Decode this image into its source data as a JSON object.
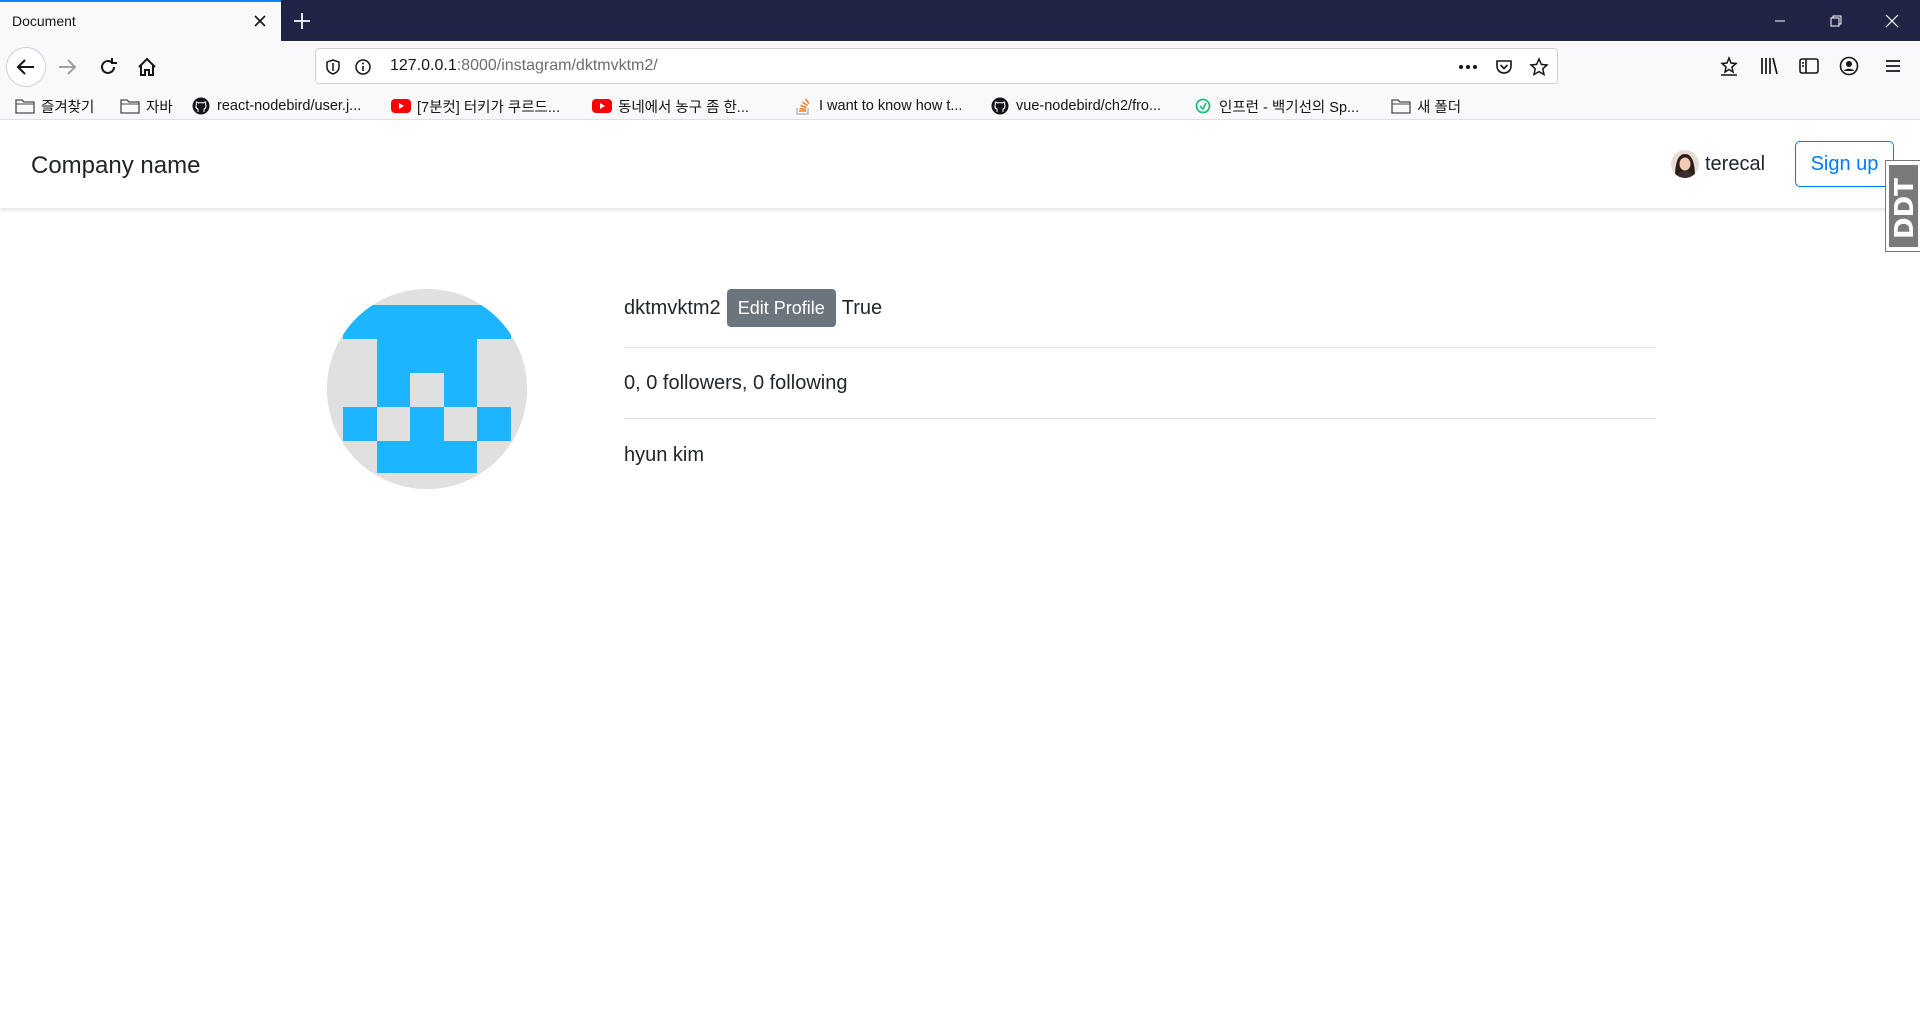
{
  "browser": {
    "tab_title": "Document",
    "url_host": "127.0.0.1",
    "url_rest": ":8000/instagram/dktmvktm2/",
    "bookmarks": [
      {
        "label": "즐겨찾기",
        "icon": "folder-icon"
      },
      {
        "label": "자바",
        "icon": "folder-icon"
      },
      {
        "label": "react-nodebird/user.j...",
        "icon": "github-icon"
      },
      {
        "label": "[7분컷] 터키가 쿠르드...",
        "icon": "youtube-icon"
      },
      {
        "label": "동네에서 농구 좀 한...",
        "icon": "youtube-icon"
      },
      {
        "label": "I want to know how t...",
        "icon": "stackoverflow-icon"
      },
      {
        "label": "vue-nodebird/ch2/fro...",
        "icon": "github-icon"
      },
      {
        "label": "인프런 - 백기선의 Sp...",
        "icon": "inflearn-icon"
      },
      {
        "label": "새 폴더",
        "icon": "folder-icon"
      }
    ]
  },
  "header": {
    "brand": "Company name",
    "username": "terecal",
    "signup_label": "Sign up",
    "extension_badge": "DDT"
  },
  "profile": {
    "username": "dktmvktm2",
    "edit_label": "Edit Profile",
    "flag_text": "True",
    "stats_text": "0, 0 followers, 0 following",
    "full_name": "hyun kim"
  },
  "colors": {
    "accent": "#007bff",
    "identicon": "#1eb5ff",
    "edit_button": "#6c757d",
    "titlebar": "#1f2344"
  }
}
